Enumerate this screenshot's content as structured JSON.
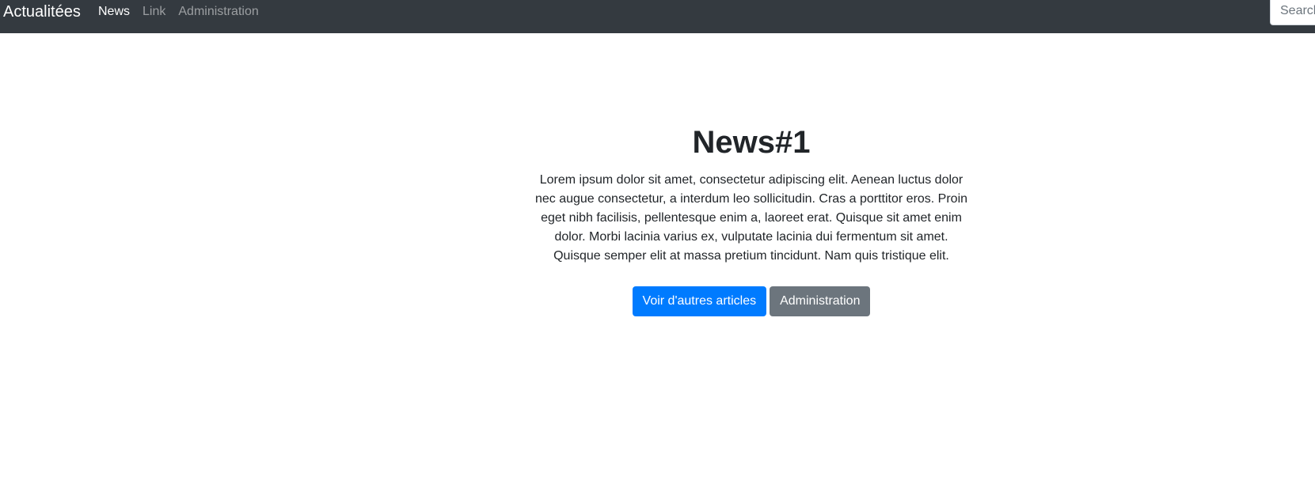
{
  "navbar": {
    "brand": "Actualitées",
    "links": [
      {
        "label": "News",
        "active": true
      },
      {
        "label": "Link",
        "active": false
      },
      {
        "label": "Administration",
        "active": false
      }
    ],
    "search_placeholder": "Search"
  },
  "jumbotron": {
    "title": "News#1",
    "text": "Lorem ipsum dolor sit amet, consectetur adipiscing elit. Aenean luctus dolor nec augue consectetur, a interdum leo sollicitudin. Cras a porttitor eros. Proin eget nibh facilisis, pellentesque enim a, laoreet erat. Quisque sit amet enim dolor. Morbi lacinia varius ex, vulputate lacinia dui fermentum sit amet. Quisque semper elit at massa pretium tincidunt. Nam quis tristique elit.",
    "primary_button": "Voir d'autres articles",
    "secondary_button": "Administration"
  },
  "colors": {
    "navbar_bg": "#343a40",
    "primary": "#007bff",
    "secondary": "#6c757d"
  }
}
